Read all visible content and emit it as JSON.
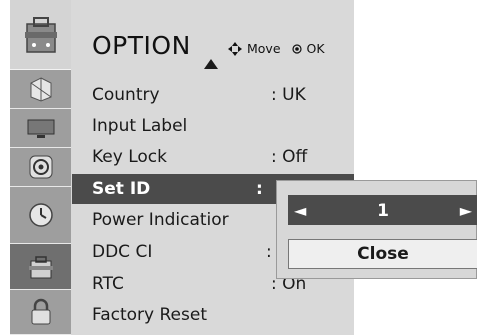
{
  "menu": {
    "title": "OPTION",
    "hint_move": "Move",
    "hint_ok": "OK",
    "items": [
      {
        "label": "Country",
        "value": ": UK"
      },
      {
        "label": "Input Label",
        "value": ""
      },
      {
        "label": "Key Lock",
        "value": ": Off"
      },
      {
        "label": "Set ID",
        "value": ":"
      },
      {
        "label": "Power Indicatior",
        "value": ""
      },
      {
        "label": "DDC CI",
        "value": ":"
      },
      {
        "label": "RTC",
        "value": ": On"
      },
      {
        "label": "Factory Reset",
        "value": ""
      }
    ],
    "selected_index": 3
  },
  "sidebar_icons": [
    "option-toolbox-icon",
    "picture-icon",
    "screen-icon",
    "audio-icon",
    "time-icon",
    "option-icon",
    "lock-icon"
  ],
  "popup": {
    "value": "1",
    "close_label": "Close"
  },
  "colors": {
    "menu_bg": "#d9d9d9",
    "selected_bg": "#4b4b4b",
    "sidebar_active": "#6f6f6f"
  }
}
